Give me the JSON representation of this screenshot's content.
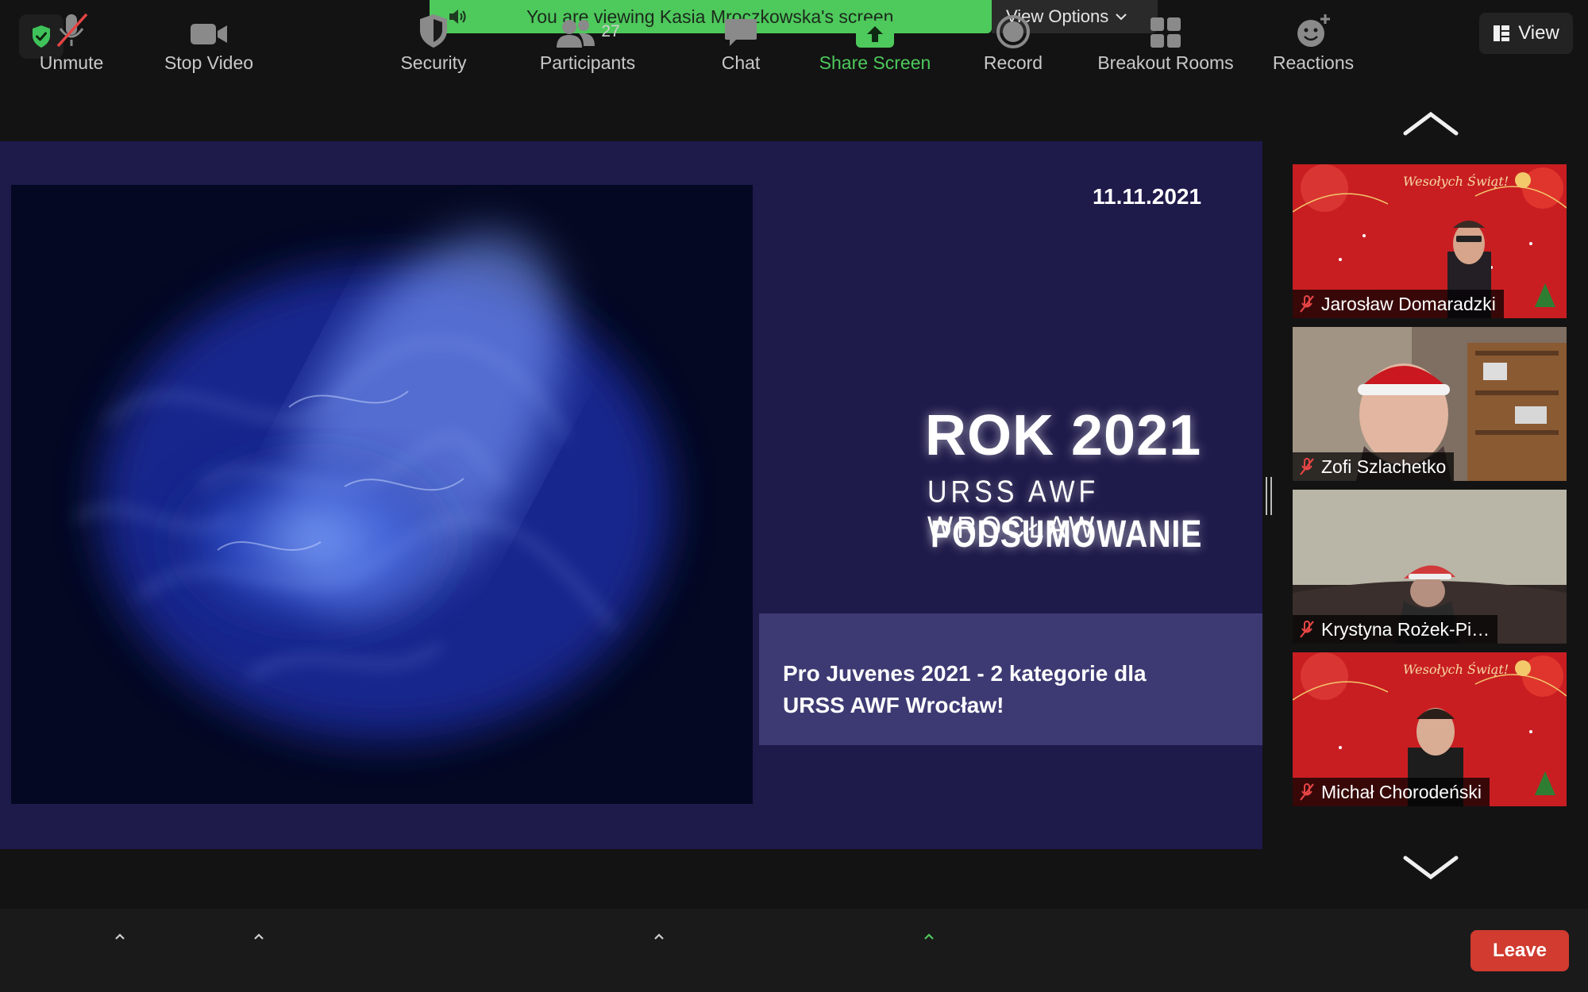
{
  "banner": {
    "text": "You are viewing Kasia Mroczkowska's screen",
    "view_options_label": "View Options",
    "color": "#4ec95c"
  },
  "view_button": {
    "label": "View"
  },
  "slide": {
    "date": "11.11.2021",
    "title_rok": "ROK 2021",
    "subtitle": "URSS AWF WROCŁAW",
    "summary": "PODSUMOWANIE",
    "caption_line1": "Pro Juvenes 2021 - 2 kategorie dla",
    "caption_line2": "URSS AWF Wrocław!"
  },
  "participants_gallery": [
    {
      "name": "Jarosław Domaradzki",
      "banner_text": "Wesołych Świąt!"
    },
    {
      "name": "Zofi Szlachetko"
    },
    {
      "name": "Krystyna Rożek-Pi…"
    },
    {
      "name": "Michał Chorodeński",
      "banner_text": "Wesołych Świąt!"
    }
  ],
  "toolbar": {
    "unmute": "Unmute",
    "stop_video": "Stop Video",
    "security": "Security",
    "participants": "Participants",
    "participants_count": "27",
    "chat": "Chat",
    "share_screen": "Share Screen",
    "record": "Record",
    "breakout_rooms": "Breakout Rooms",
    "reactions": "Reactions",
    "leave": "Leave"
  },
  "colors": {
    "share_green": "#4ec95c",
    "leave_red": "#d13b30",
    "slide_bg": "#1e1a4a",
    "caption_bg": "#3d3a73"
  }
}
